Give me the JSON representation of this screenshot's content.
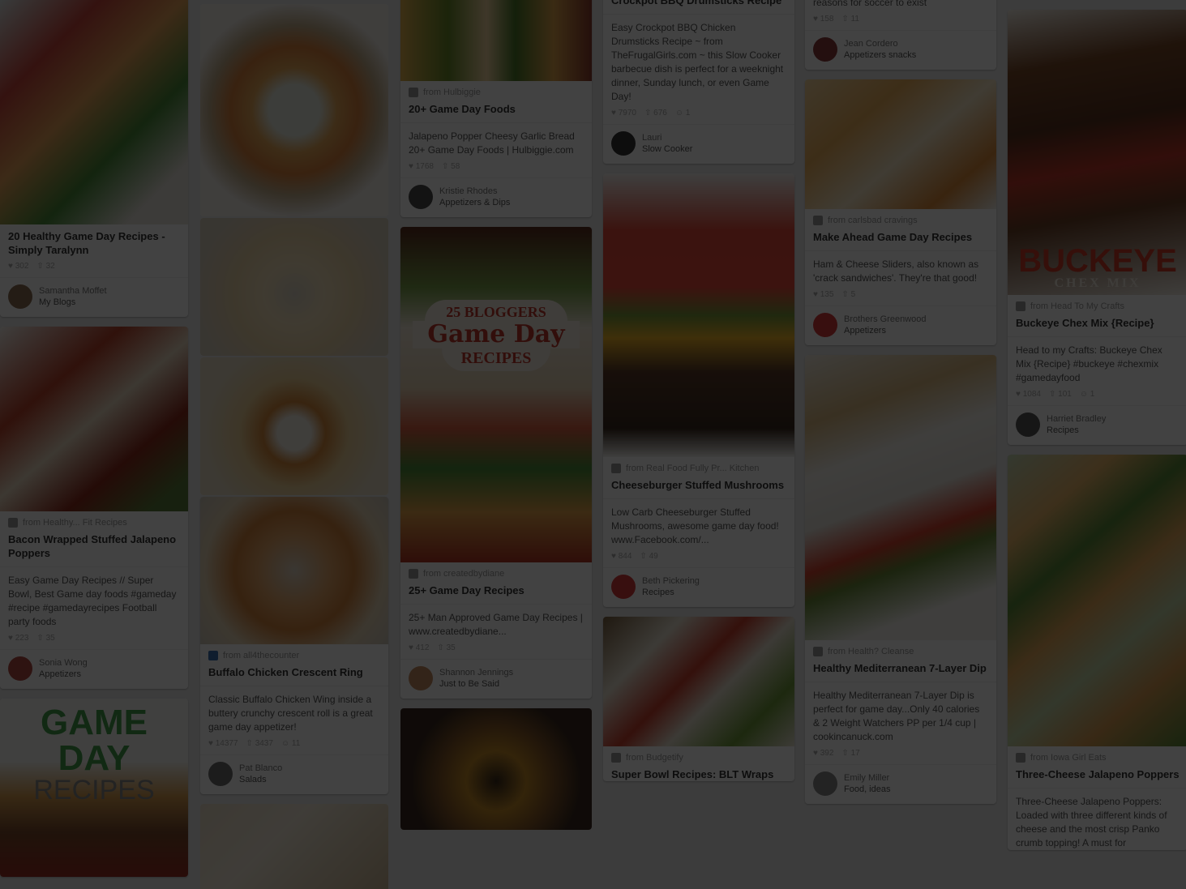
{
  "columns": [
    {
      "pins": [
        {
          "image": {
            "label": "",
            "h": 282,
            "bg": "linear-gradient(135deg,#d9e8e8 0%,#c9473d 25%,#e8a35a 45%,#4b8c3a 65%,#e6e2da 85%)"
          },
          "title": "20 Healthy Game Day Recipes - Simply Taralynn",
          "source": "",
          "description": "",
          "stats": [
            "♥ 302",
            "⇧ 32"
          ],
          "pinner": "Samantha Moffet",
          "board": "My Blogs",
          "avatar_color": "#8a6b52"
        },
        {
          "image": {
            "label": "",
            "h": 228,
            "bg": "linear-gradient(140deg,#f3f0ea 0%,#b8432c 30%,#e9d8c0 50%,#8c2b1d 70%,#5b7c3a 90%)"
          },
          "title": "Bacon Wrapped Stuffed Jalapeno Poppers",
          "source": "from Healthy... Fit Recipes",
          "source_color": "#999",
          "description": "Easy Game Day Recipes // Super Bowl, Best Game day foods #gameday #recipe #gamedayrecipes Football party foods",
          "stats": [
            "♥ 223",
            "⇧ 35"
          ],
          "pinner": "Sonia Wong",
          "board": "Appetizers",
          "avatar_color": "#b04c43"
        },
        {
          "image": {
            "label": "GAME DAY",
            "label2": "RECIPES",
            "h": 220,
            "bg": "linear-gradient(180deg,#f6f8f4 0%,#f6f8f4 35%,#d49a4e 55%,#7a4a2b 75%,#9a2d23 100%)",
            "label_color": "#43a04a",
            "label2_color": "#888"
          },
          "title": "",
          "source": "",
          "description": "",
          "stats": [],
          "pinner": "",
          "board": ""
        }
      ]
    },
    {
      "pins": [
        {
          "image": {
            "label": "",
            "h": 262,
            "bg": "radial-gradient(circle at 50% 50%,#e9ece1 0%,#e9ece1 18%,#e7a95a 30%,#d9823e 45%,#c5b08e 60%,#f1ede7 75%)"
          },
          "title": "",
          "source": "",
          "description": "",
          "stats": [],
          "pinner": "",
          "board": "",
          "nometa": true
        },
        {
          "image": {
            "label": "",
            "h": 170,
            "bg": "radial-gradient(circle at 50% 55%,#dcd4c4 0%,#f4e2bd 25%,#ead4a8 50%,#d9cfbe 80%)"
          },
          "title": "",
          "source": "",
          "description": "",
          "stats": [],
          "pinner": "",
          "board": "",
          "nometa": true,
          "flush": true
        },
        {
          "image": {
            "label": "",
            "h": 170,
            "bg": "radial-gradient(circle at 50% 55%,#f2ede3 0%,#f2ede3 14%,#d58a3d 26%,#eccf97 45%,#e7dcc6 75%)"
          },
          "title": "",
          "source": "",
          "description": "",
          "stats": [],
          "pinner": "",
          "board": "",
          "nometa": true,
          "flush": true
        },
        {
          "image": {
            "label": "",
            "h": 182,
            "bg": "radial-gradient(circle at 50% 50%,#ddd3c2 0%,#e4a669 30%,#d0823d 50%,#e6d5b6 75%,#cfc8bb 100%)"
          },
          "title": "Buffalo Chicken Crescent Ring",
          "source": "from all4thecounter",
          "source_color": "#3b6fb3",
          "description": "Classic Buffalo Chicken Wing inside a buttery crunchy crescent roll is a great game day appetizer!",
          "stats": [
            "♥ 14377",
            "⇧ 3437",
            "☺ 11"
          ],
          "pinner": "Pat Blanco",
          "board": "Salads",
          "avatar_color": "#6d6d6d"
        },
        {
          "image": {
            "label": "",
            "h": 110,
            "bg": "linear-gradient(135deg,#e9dcc6 0%,#f3ead8 40%,#cbb694 100%)"
          },
          "title": "",
          "source": "",
          "description": "",
          "stats": [],
          "pinner": "",
          "board": "",
          "nometa": true
        }
      ]
    },
    {
      "pins": [
        {
          "image": {
            "label": "",
            "h": 110,
            "bg": "linear-gradient(90deg,#e3b24f 0%,#6a8a2a 25%,#f1d5a0 45%,#4d7a2a 60%,#e0a54c 80%,#8c3b2d 100%)"
          },
          "title": "20+ Game Day Foods",
          "source": "from Hulbiggie",
          "source_color": "#999",
          "description": "Jalapeno Popper Cheesy Garlic Bread 20+ Game Day Foods | Hulbiggie.com",
          "stats": [
            "♥ 1768",
            "⇧ 58"
          ],
          "pinner": "Kristie Rhodes",
          "board": "Appetizers & Dips",
          "avatar_color": "#4a4a4a"
        },
        {
          "image": {
            "label": "25 BLOGGERS",
            "label2": "Game Day",
            "label3": "RECIPES",
            "h": 414,
            "bg": "linear-gradient(180deg,#5a2b1e 0%,#7aa04a 18%,#efe6d6 30%,#e7d3b5 48%,#d95f42 60%,#4b8c3a 72%,#e3a24a 85%,#b23524 100%)",
            "label_color": "#c0392b",
            "label2_color": "#c0392b",
            "label3_color": "#c0392b"
          },
          "title": "25+ Game Day Recipes",
          "source": "from createdbydiane",
          "source_color": "#999",
          "description": "25+ Man Approved Game Day Recipes | www.createdbydiane...",
          "stats": [
            "♥ 412",
            "⇧ 35"
          ],
          "pinner": "Shannon Jennings",
          "board": "Just to Be Said",
          "avatar_color": "#c48a60"
        },
        {
          "image": {
            "label": "",
            "h": 150,
            "bg": "radial-gradient(circle at 50% 60%,#3a2a1a 0%,#c48a2a 25%,#8a5b2a 45%,#3b2a20 70%)"
          },
          "title": "",
          "source": "",
          "description": "",
          "stats": [],
          "pinner": "",
          "board": "",
          "nometa": true
        }
      ]
    },
    {
      "pins": [
        {
          "image": {
            "label": "",
            "h": 0,
            "bg": "#fff"
          },
          "title": "Crockpot BBQ Drumsticks Recipe",
          "source": "",
          "description": "Easy Crockpot BBQ Chicken Drumsticks Recipe ~ from TheFrugalGirls.com ~ this Slow Cooker barbecue dish is perfect for a weeknight dinner, Sunday lunch, or even Game Day!",
          "stats": [
            "♥ 7970",
            "⇧ 676",
            "☺ 1"
          ],
          "pinner": "Lauri",
          "board": "Slow Cooker",
          "avatar_color": "#333"
        },
        {
          "image": {
            "label": "",
            "h": 350,
            "bg": "linear-gradient(180deg,#f2f2ee 0%,#e34b3b 20%,#e84a3a 40%,#7a9a3a 50%,#f0b52a 58%,#5a3a28 70%,#3a2a20 90%,#f2f2ee 100%)"
          },
          "title": "Cheeseburger Stuffed Mushrooms",
          "source": "from Real Food Fully Pr... Kitchen",
          "source_color": "#999",
          "description": "Low Carb Cheeseburger Stuffed Mushrooms, awesome game day food! www.Facebook.com/...",
          "stats": [
            "♥ 844",
            "⇧ 49"
          ],
          "pinner": "Beth Pickering",
          "board": "Recipes",
          "avatar_color": "#d63a3a"
        },
        {
          "image": {
            "label": "",
            "h": 160,
            "bg": "linear-gradient(135deg,#7a6040 0%,#e9e2d2 25%,#c9402e 45%,#e7e0cf 60%,#6f9a3a 80%,#e9e2d2 100%)"
          },
          "title": "Super Bowl Recipes: BLT Wraps",
          "source": "from Budgetify",
          "source_color": "#999",
          "description": "",
          "stats": [],
          "pinner": "",
          "board": ""
        }
      ]
    },
    {
      "pins": [
        {
          "image": {
            "label": "",
            "h": 0,
            "bg": "#fff"
          },
          "title": "",
          "source": "",
          "description": "appetizer - it may be one of the best reasons for soccer to exist",
          "stats": [
            "♥ 158",
            "⇧ 11"
          ],
          "pinner": "Jean Cordero",
          "board": "Appetizers snacks",
          "avatar_color": "#8a3a3a"
        },
        {
          "image": {
            "label": "",
            "h": 160,
            "bg": "linear-gradient(140deg,#f4d6a0 0%,#e9ae5b 30%,#f5e6c6 55%,#d98a3a 80%,#f0efe9 100%)"
          },
          "title": "Make Ahead Game Day Recipes",
          "source": "from carlsbad cravings",
          "source_color": "#999",
          "description": "Ham & Cheese Sliders, also known as 'crack sandwiches'. They're that good!",
          "stats": [
            "♥ 135",
            "⇧ 5"
          ],
          "pinner": "Brothers Greenwood",
          "board": "Appetizers",
          "avatar_color": "#d63a3a"
        },
        {
          "image": {
            "label": "",
            "h": 352,
            "bg": "linear-gradient(160deg,#f0ebe0 0%,#d9b982 20%,#f2f0ea 35%,#e6e2da 50%,#d3432f 62%,#6a8a3a 70%,#f2f0ea 85%)"
          },
          "title": "Healthy Mediterranean 7-Layer Dip",
          "source": "from Health? Cleanse",
          "source_color": "#999",
          "description": "Healthy Mediterranean 7-Layer Dip is perfect for game day...Only 40 calories & 2 Weight Watchers PP per 1/4 cup | cookincanuck.com",
          "stats": [
            "♥ 392",
            "⇧ 17"
          ],
          "pinner": "Emily Miller",
          "board": "Food, ideas",
          "avatar_color": "#888"
        }
      ]
    },
    {
      "pins": [
        {
          "image": {
            "label": "BUCKEYE",
            "label2": "CHEX MIX",
            "h": 352,
            "bg": "linear-gradient(170deg,#f2ede4 0%,#7a4a2a 20%,#5a3320 40%,#c0392b 55%,#6b4128 70%,#f2ede4 100%)",
            "label_color": "#d13a2a",
            "label2_color": "#f0e8dc"
          },
          "title": "Buckeye Chex Mix {Recipe}",
          "source": "from Head To My Crafts",
          "source_color": "#999",
          "description": "Head to my Crafts: Buckeye Chex Mix {Recipe} #buckeye #chexmix #gamedayfood",
          "stats": [
            "♥ 1084",
            "⇧ 101",
            "☺ 1"
          ],
          "pinner": "Harriet Bradley",
          "board": "Recipes",
          "avatar_color": "#555"
        },
        {
          "image": {
            "label": "",
            "h": 360,
            "bg": "linear-gradient(140deg,#c7d9b5 0%,#e9b66a 20%,#5a8a3a 35%,#e3a85a 50%,#c4d6a8 65%,#d89c52 80%,#5a8a3a 100%)"
          },
          "title": "Three-Cheese Jalapeno Poppers",
          "source": "from Iowa Girl Eats",
          "source_color": "#999",
          "description": "Three-Cheese Jalapeno Poppers: Loaded with three different kinds of cheese and the most crisp Panko crumb topping! A must for",
          "stats": [],
          "pinner": "",
          "board": ""
        }
      ]
    }
  ],
  "col_offsets": [
    0,
    0,
    0,
    0,
    0,
    0
  ]
}
